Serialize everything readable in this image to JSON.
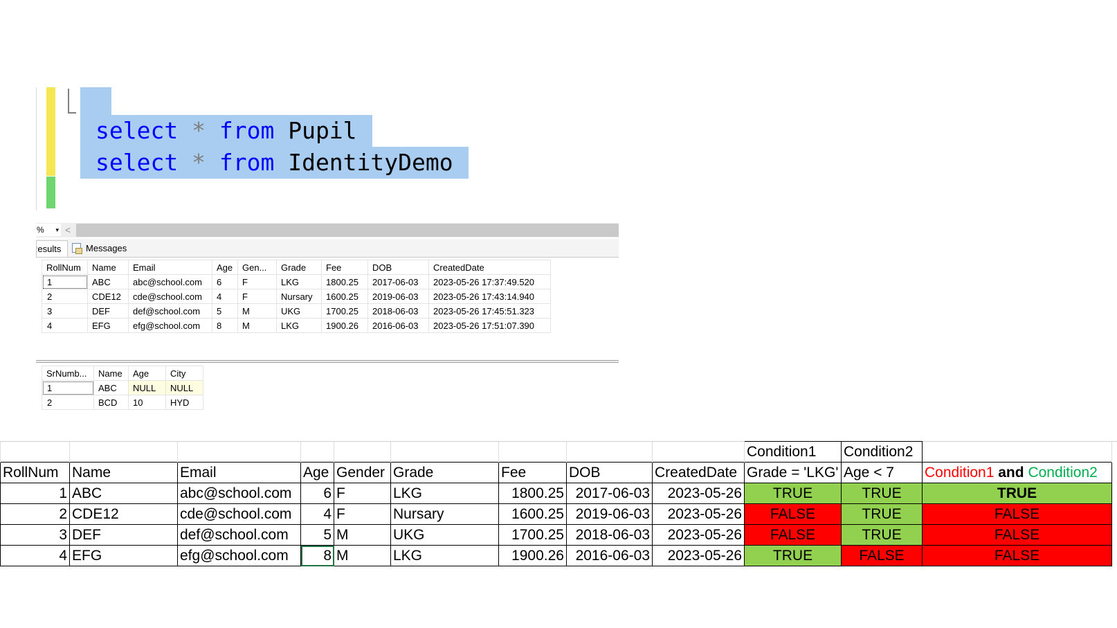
{
  "editor": {
    "lines": [
      {
        "kw1": "select",
        "op": "*",
        "kw2": "from",
        "table": "Pupil"
      },
      {
        "kw1": "select",
        "op": "*",
        "kw2": "from",
        "table": "IdentityDemo"
      }
    ]
  },
  "toolbar": {
    "zoom": "%",
    "dropdown": "▾",
    "scroll_left": "<"
  },
  "tabs": {
    "results": "Results",
    "messages": "Messages"
  },
  "grid1": {
    "headers": [
      "RollNum",
      "Name",
      "Email",
      "Age",
      "Gen...",
      "Grade",
      "Fee",
      "DOB",
      "CreatedDate"
    ],
    "rows": [
      [
        "1",
        "ABC",
        "abc@school.com",
        "6",
        "F",
        "LKG",
        "1800.25",
        "2017-06-03",
        "2023-05-26 17:37:49.520"
      ],
      [
        "2",
        "CDE12",
        "cde@school.com",
        "4",
        "F",
        "Nursary",
        "1600.25",
        "2019-06-03",
        "2023-05-26 17:43:14.940"
      ],
      [
        "3",
        "DEF",
        "def@school.com",
        "5",
        "M",
        "UKG",
        "1700.25",
        "2018-06-03",
        "2023-05-26 17:45:51.323"
      ],
      [
        "4",
        "EFG",
        "efg@school.com",
        "8",
        "M",
        "LKG",
        "1900.26",
        "2016-06-03",
        "2023-05-26 17:51:07.390"
      ]
    ]
  },
  "grid2": {
    "headers": [
      "SrNumb...",
      "Name",
      "Age",
      "City"
    ],
    "rows": [
      [
        "1",
        "ABC",
        "NULL",
        "NULL"
      ],
      [
        "2",
        "BCD",
        "10",
        "HYD"
      ]
    ]
  },
  "sheet": {
    "cond_top": {
      "c1": "Condition1",
      "c2": "Condition2"
    },
    "headers": [
      "RollNum",
      "Name",
      "Email",
      "Age",
      "Gender",
      "Grade",
      "Fee",
      "DOB",
      "CreatedDate",
      "Grade = 'LKG'",
      "Age < 7"
    ],
    "combined": {
      "a": "Condition1",
      "and": "and",
      "b": "Condition2"
    },
    "rows": [
      [
        "1",
        "ABC",
        "abc@school.com",
        "6",
        "F",
        "LKG",
        "1800.25",
        "2017-06-03",
        "2023-05-26",
        "TRUE",
        "TRUE",
        "TRUE"
      ],
      [
        "2",
        "CDE12",
        "cde@school.com",
        "4",
        "F",
        "Nursary",
        "1600.25",
        "2019-06-03",
        "2023-05-26",
        "FALSE",
        "TRUE",
        "FALSE"
      ],
      [
        "3",
        "DEF",
        "def@school.com",
        "5",
        "M",
        "UKG",
        "1700.25",
        "2018-06-03",
        "2023-05-26",
        "FALSE",
        "TRUE",
        "FALSE"
      ],
      [
        "4",
        "EFG",
        "efg@school.com",
        "8",
        "M",
        "LKG",
        "1900.26",
        "2016-06-03",
        "2023-05-26",
        "TRUE",
        "FALSE",
        "FALSE"
      ]
    ]
  },
  "colors": {
    "true": "#92d050",
    "false": "#ff0000",
    "keyword": "#0000ff",
    "selection": "#a9cdf0"
  }
}
